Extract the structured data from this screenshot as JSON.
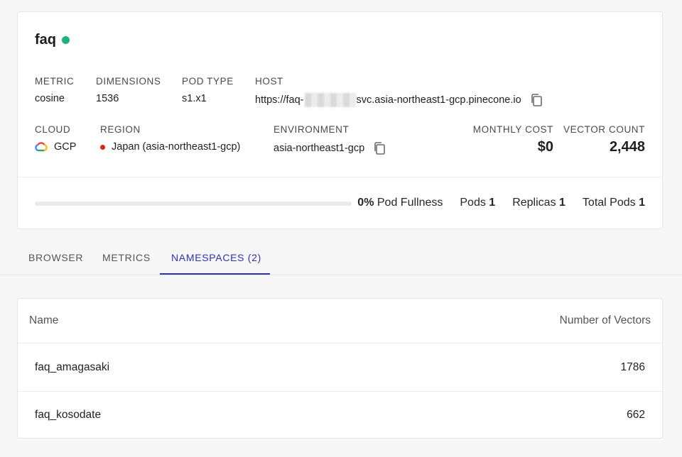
{
  "index": {
    "name": "faq",
    "status_color": "#1bb37a"
  },
  "details": {
    "metric": {
      "label": "METRIC",
      "value": "cosine"
    },
    "dimensions": {
      "label": "DIMENSIONS",
      "value": "1536"
    },
    "pod_type": {
      "label": "POD TYPE",
      "value": "s1.x1"
    },
    "host": {
      "label": "HOST",
      "prefix": "https://faq-",
      "suffix": "svc.asia-northeast1-gcp.pinecone.io"
    },
    "cloud": {
      "label": "CLOUD",
      "value": "GCP",
      "icon": "gcp-icon"
    },
    "region": {
      "label": "REGION",
      "value": "Japan (asia-northeast1-gcp)"
    },
    "environment": {
      "label": "ENVIRONMENT",
      "value": "asia-northeast1-gcp"
    },
    "monthly_cost": {
      "label": "MONTHLY COST",
      "value": "$0"
    },
    "vector_count": {
      "label": "VECTOR COUNT",
      "value": "2,448"
    }
  },
  "usage": {
    "fullness_value": "0%",
    "fullness_label": "Pod Fullness",
    "fullness_fraction": 0,
    "pods_label": "Pods",
    "pods_value": "1",
    "replicas_label": "Replicas",
    "replicas_value": "1",
    "total_pods_label": "Total Pods",
    "total_pods_value": "1"
  },
  "tabs": [
    {
      "label": "BROWSER"
    },
    {
      "label": "METRICS"
    },
    {
      "label": "NAMESPACES (2)",
      "active": true
    }
  ],
  "namespaces": {
    "columns": [
      "Name",
      "Number of Vectors"
    ],
    "rows": [
      {
        "name": "faq_amagasaki",
        "vectors": "1786"
      },
      {
        "name": "faq_kosodate",
        "vectors": "662"
      }
    ]
  },
  "colors": {
    "accent": "#2f2fb6",
    "status_green": "#1bb37a",
    "region_red": "#e0241b"
  }
}
